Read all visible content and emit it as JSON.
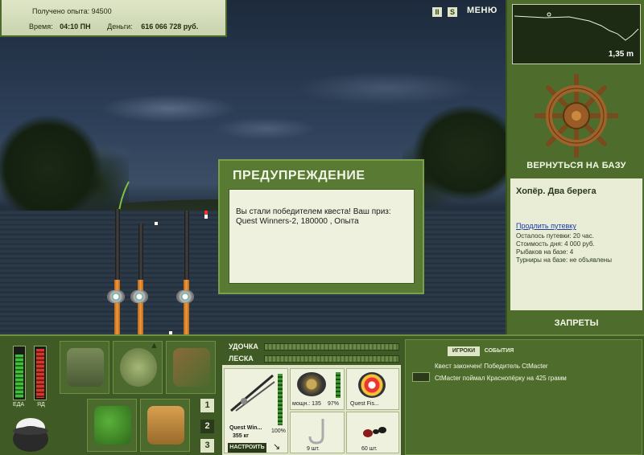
{
  "hud": {
    "xp_label": "Получено опыта: 94500",
    "time_label": "Время:",
    "time_value": "04:10 ПН",
    "money_label": "Деньги:",
    "money_value": "616 066 728 руб."
  },
  "topbar": {
    "pause_glyph": "II",
    "sound_glyph": "S",
    "menu_label": "МЕНЮ"
  },
  "depth": {
    "value": "1,35 m"
  },
  "right_panel": {
    "return_label": "ВЕРНУТЬСЯ НА БАЗУ",
    "location_title": "Хопёр. Два берега",
    "extend_link": "Продлить путевку",
    "lines": [
      "Осталось путевки: 20 час.",
      "Стоимость дня: 4 000 руб.",
      "Рыбаков на базе: 4",
      "Турниры на базе: не объявлены"
    ],
    "bans_label": "ЗАПРЕТЫ"
  },
  "modal": {
    "title": "ПРЕДУПРЕЖДЕНИЕ",
    "message": "Вы стали победителем квеста! Ваш приз: Quest Winners-2, 180000 , Опыта"
  },
  "meters": {
    "food_label": "ЕДА",
    "poison_label": "ЯД",
    "food_level": 0.85,
    "poison_level": 0.95
  },
  "inventory": {
    "page_buttons": [
      "1",
      "2",
      "3"
    ],
    "active_page": "2"
  },
  "tackle": {
    "rod_label": "УДОЧКА",
    "line_label": "ЛЕСКА",
    "rod_name": "Quest Win...",
    "rod_weight": "355 кг",
    "rod_condition": "100%",
    "reel_power": "мощн.: 135",
    "reel_condition": "97%",
    "line_name": "Quest Fis...",
    "hook_count": "9 шт.",
    "bait_count": "60 шт.",
    "setup_label": "НАСТРОИТЬ"
  },
  "events": {
    "tab_players": "ИГРОКИ",
    "tab_events": "СОБЫТИЯ",
    "messages": [
      "Квест закончен! Победитель CtMacter",
      "CtMacter поймал Краснопёрку на 425 грамм"
    ]
  },
  "colors": {
    "panel_green": "#4e6d2c",
    "dark_green": "#3f5a25",
    "cream": "#dfe6c8",
    "accent_orange": "#f09a3a"
  }
}
